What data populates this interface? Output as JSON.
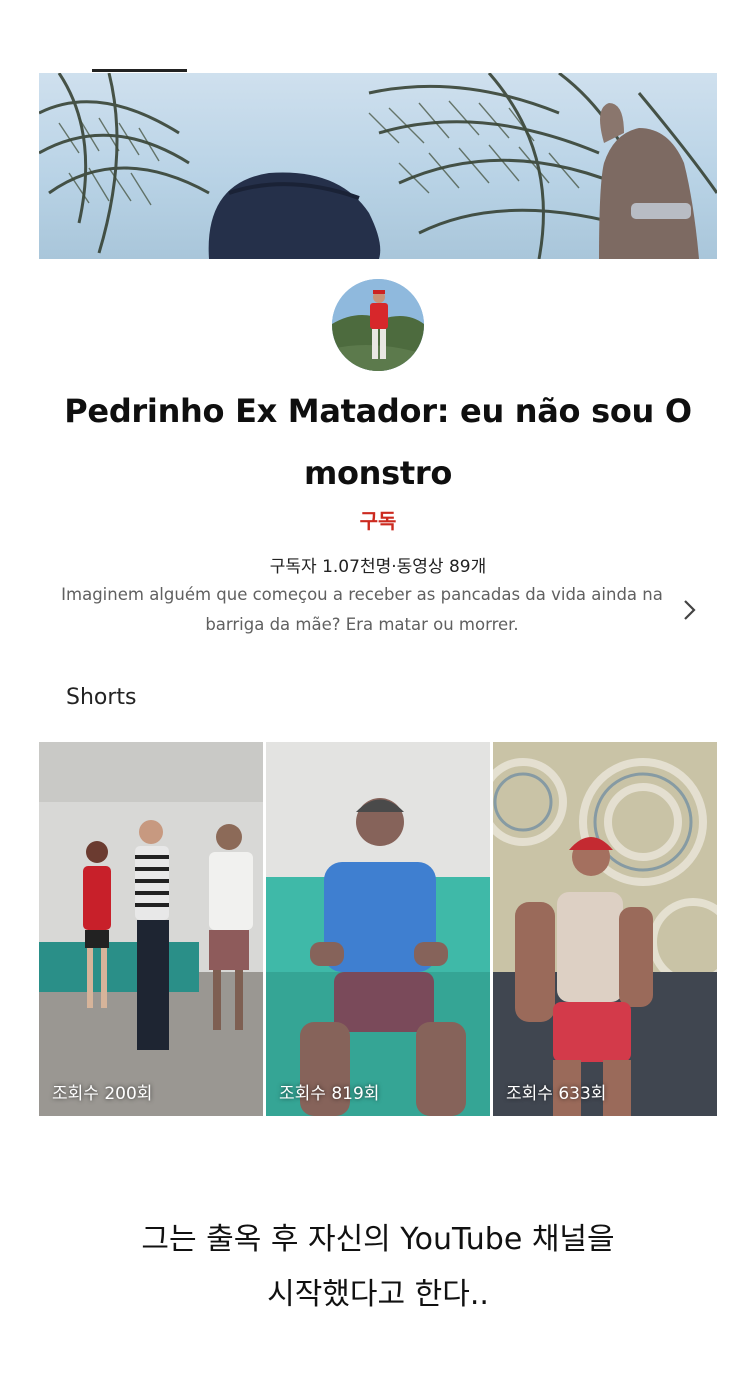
{
  "channel": {
    "name": "Pedrinho Ex Matador: eu não sou O monstro",
    "subscribe_label": "구독",
    "stats": "구독자 1.07천명·동영상 89개",
    "description": "Imaginem alguém que começou a receber as pancadas da vida ainda na barriga da mãe? Era matar ou morrer."
  },
  "shorts": {
    "section_title": "Shorts",
    "items": [
      {
        "views": "조회수 200회"
      },
      {
        "views": "조회수 819회"
      },
      {
        "views": "조회수 633회"
      }
    ]
  },
  "caption": {
    "line1": "그는 출옥 후 자신의 YouTube 채널을",
    "line2": "시작했다고 한다.."
  },
  "colors": {
    "subscribe": "#cc2a1f",
    "description": "#606060"
  },
  "icons": {
    "description_more": "chevron-right-icon"
  }
}
